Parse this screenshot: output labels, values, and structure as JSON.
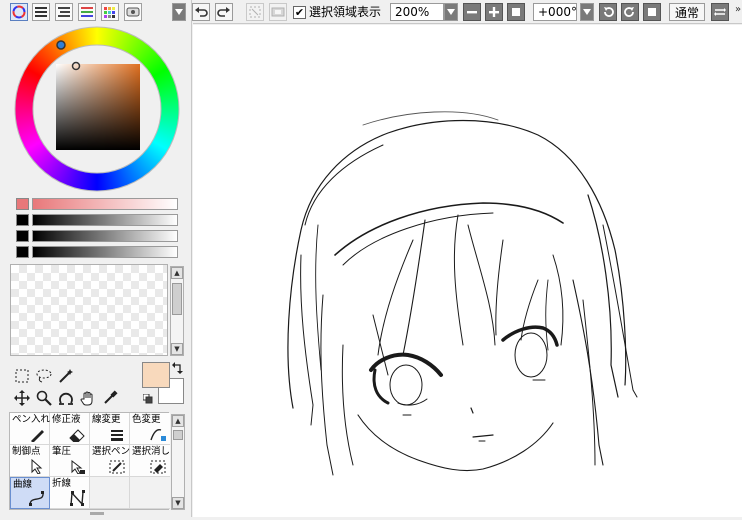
{
  "left_panel": {
    "color_tabs": [
      {
        "icon": "color-wheel-icon",
        "active": true
      },
      {
        "icon": "rgb-sliders-icon",
        "active": false
      },
      {
        "icon": "hsv-sliders-icon",
        "active": false
      },
      {
        "icon": "color-swatches-icon",
        "active": false
      },
      {
        "icon": "color-grid-icon",
        "active": false
      },
      {
        "icon": "scratchpad-icon",
        "active": false
      }
    ],
    "color_wheel": {
      "hue_marker_color": "#2f7fd6",
      "square_base": "#e07020"
    },
    "sliders": [
      {
        "swatch": "#e8787a",
        "track_from": "#e8787a",
        "track_to": "#ffffff"
      },
      {
        "swatch": "#000000",
        "track_from": "#000000",
        "track_to": "#ffffff"
      },
      {
        "swatch": "#000000",
        "track_from": "#000000",
        "track_to": "#ffffff"
      },
      {
        "swatch": "#000000",
        "track_from": "#000000",
        "track_to": "#ffffff"
      }
    ],
    "colors": {
      "primary": "#f8d9bc",
      "secondary": "#ffffff"
    },
    "tools": [
      {
        "name": "rect-select-icon"
      },
      {
        "name": "lasso-icon"
      },
      {
        "name": "magic-wand-icon"
      },
      {
        "name": "move-icon"
      },
      {
        "name": "zoom-icon"
      },
      {
        "name": "rotate-icon"
      },
      {
        "name": "hand-icon"
      },
      {
        "name": "eyedropper-icon"
      }
    ],
    "brushes": [
      {
        "label": "ペン入れ",
        "icon": "pen-icon",
        "selected": false
      },
      {
        "label": "修正液",
        "icon": "eraser-icon",
        "selected": false
      },
      {
        "label": "線変更",
        "icon": "line-weight-icon",
        "selected": false
      },
      {
        "label": "色変更",
        "icon": "color-change-icon",
        "selected": false
      },
      {
        "label": "制御点",
        "icon": "control-point-icon",
        "selected": false
      },
      {
        "label": "筆圧",
        "icon": "pressure-icon",
        "selected": false
      },
      {
        "label": "選択ペン",
        "icon": "select-pen-icon",
        "selected": false
      },
      {
        "label": "選択消し",
        "icon": "select-erase-icon",
        "selected": false
      },
      {
        "label": "曲線",
        "icon": "curve-icon",
        "selected": true
      },
      {
        "label": "折線",
        "icon": "polyline-icon",
        "selected": false
      }
    ]
  },
  "toolbar": {
    "show_selection_label": "選択領域表示",
    "show_selection_checked": true,
    "zoom_value": "200%",
    "rotation_value": "+000°",
    "blend_mode": "通常"
  }
}
